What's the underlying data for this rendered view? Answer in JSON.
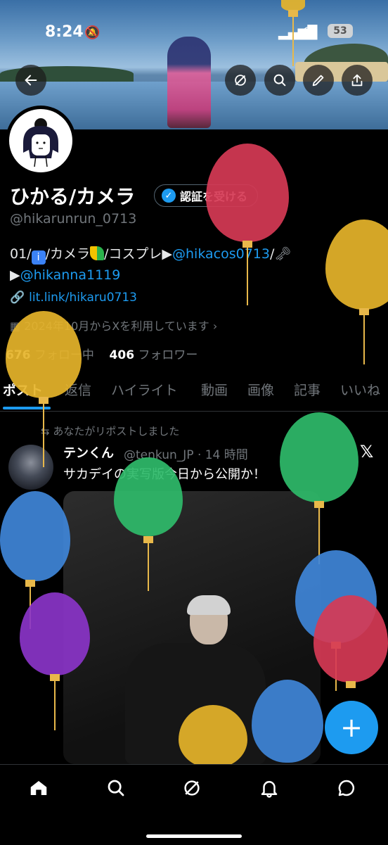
{
  "status_bar": {
    "time": "8:24",
    "battery": "53"
  },
  "profile": {
    "name": "ひかる/カメラ",
    "verify_label": "認証を受ける",
    "handle": "@hikarunrun_0713",
    "bio_line1_prefix": "01/",
    "bio_line1_mid": "/カメラ",
    "bio_line1_mid2": "/コスプレ▶",
    "bio_link1": "@hikacos0713",
    "bio_line1_suffix": "/",
    "bio_line2_prefix": "▶",
    "bio_link2": "@hikanna1119",
    "website": "lit.link/hikaru0713",
    "joined": "2024年10月からXを利用しています",
    "following_count": "676",
    "following_label": "フォロー中",
    "followers_count": "406",
    "followers_label": "フォロワー"
  },
  "tabs": [
    {
      "label": "ポスト"
    },
    {
      "label": "返信"
    },
    {
      "label": "ハイライト"
    },
    {
      "label": "動画"
    },
    {
      "label": "画像"
    },
    {
      "label": "記事"
    },
    {
      "label": "いいね"
    }
  ],
  "post": {
    "repost_label": "あなたがリポストしました",
    "author_name": "テンくん",
    "author_meta": "@tenkun_JP · 14 時間",
    "text": "サカデイの実写版今日から公開か！"
  },
  "icons": {
    "back": "arrow-left-icon",
    "grok": "grok-icon",
    "search": "search-icon",
    "edit": "pencil-icon",
    "share": "share-icon"
  },
  "colors": {
    "accent": "#1d9bf0",
    "background": "#000000"
  }
}
